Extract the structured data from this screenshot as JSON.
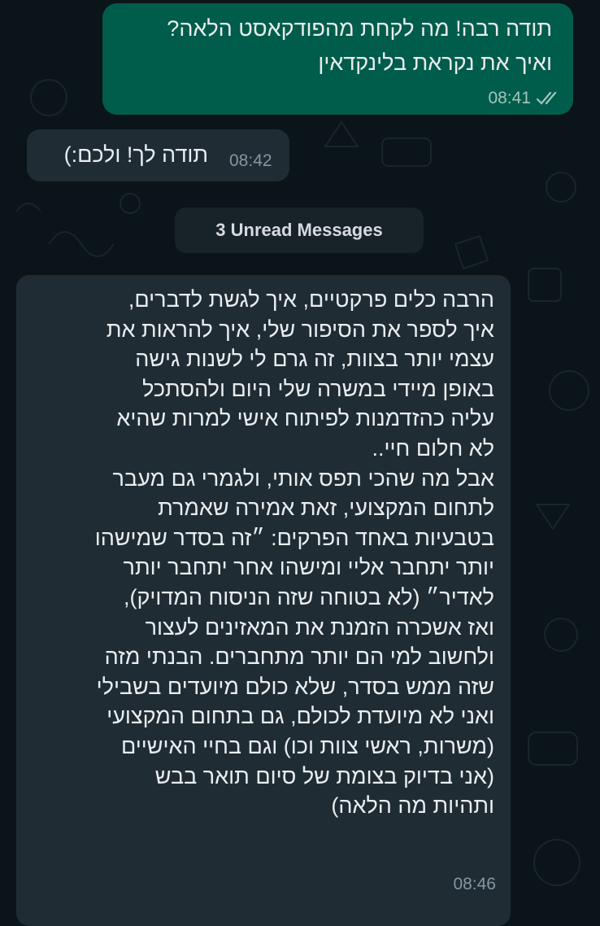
{
  "messages": {
    "outgoing": {
      "lines": [
        "תודה רבה! מה לקחת מהפודקאסט הלאה?",
        "ואיך את נקראת בלינקדאין"
      ],
      "time": "08:41",
      "status_icon": "double-check-icon",
      "colors": {
        "bubble": "#005c4b",
        "text": "#e9edef",
        "meta": "#a0c7bf"
      }
    },
    "incoming_1": {
      "text": "תודה לך! ולכם:)",
      "time": "08:42",
      "colors": {
        "bubble": "#1f2c34"
      }
    },
    "unread_banner": "3 Unread Messages",
    "incoming_2": {
      "lines": [
        "הרבה כלים פרקטיים, איך לגשת לדברים,",
        "איך לספר את הסיפור שלי, איך להראות את",
        "עצמי יותר בצוות, זה גרם לי לשנות גישה",
        "באופן מיידי במשרה שלי היום ולהסתכל",
        "עליה כהזדמנות לפיתוח אישי למרות שהיא",
        "לא חלום חיי..",
        "אבל מה שהכי תפס אותי, ולגמרי גם מעבר",
        "לתחום המקצועי, זאת אמירה שאמרת",
        "בטבעיות באחד הפרקים: ״זה בסדר שמישהו",
        "יותר יתחבר אליי ומישהו אחר יתחבר יותר",
        "לאדיר״ (לא בטוחה שזה הניסוח המדויק),",
        "ואז אשכרה הזמנת את המאזינים לעצור",
        "ולחשוב  למי הם יותר מתחברים. הבנתי מזה",
        "שזה ממש בסדר, שלא כולם מיועדים בשבילי",
        "ואני לא מיועדת לכולם, גם בתחום המקצועי",
        "(משרות, ראשי צוות וכו) וגם בחיי האישיים",
        "(אני בדיוק בצומת של סיום תואר בבש",
        "ותהיות מה הלאה)"
      ],
      "time": "08:46"
    }
  },
  "theme": {
    "background": "#0b1418",
    "incoming_bubble": "#1f2c34",
    "banner": "#182229"
  }
}
